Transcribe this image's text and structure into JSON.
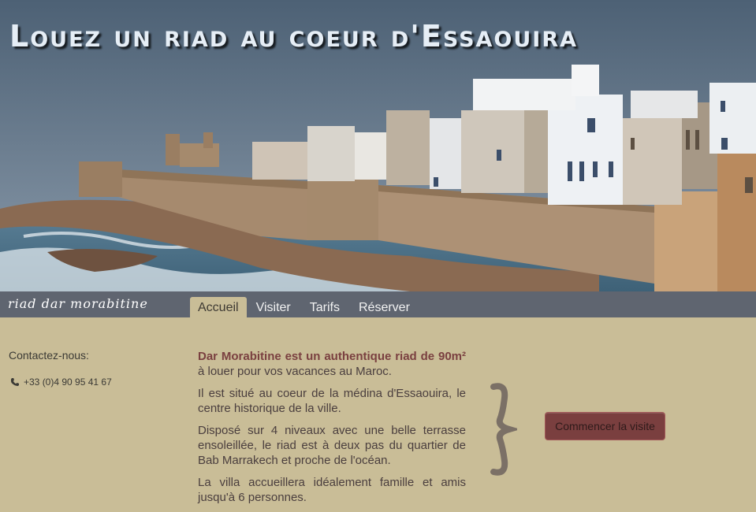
{
  "header": {
    "title": "Louez un riad au coeur d'Essaouira",
    "hero_image": "essaouira-ramparts-photo"
  },
  "nav": {
    "logo": "riad dar morabitine",
    "tabs": [
      {
        "label": "Accueil",
        "active": true
      },
      {
        "label": "Visiter",
        "active": false
      },
      {
        "label": "Tarifs",
        "active": false
      },
      {
        "label": "Réserver",
        "active": false
      }
    ]
  },
  "contact": {
    "title": "Contactez-nous:",
    "phone_icon": "phone-icon",
    "phone": "+33 (0)4 90 95 41 67"
  },
  "intro": {
    "p1_strong": "Dar Morabitine est un authentique riad de 90m²",
    "p1_rest": " à louer pour vos vacances au Maroc.",
    "p2": "Il est situé au coeur de la médina d'Essaouira, le centre historique de la ville.",
    "p3": "Disposé sur 4 niveaux avec une belle terrasse ensoleillée, le riad est à deux pas du quartier de Bab Marrakech et proche de l'océan.",
    "p4": "La villa accueillera idéalement famille et amis jusqu'à 6 personnes."
  },
  "cta": {
    "label": "Commencer la visite"
  },
  "colors": {
    "sand_background": "#c9bd97",
    "nav_bar": "#5f6570",
    "accent_text": "#7a4040",
    "button": "#7a3f3f",
    "brace": "#7b7066"
  }
}
